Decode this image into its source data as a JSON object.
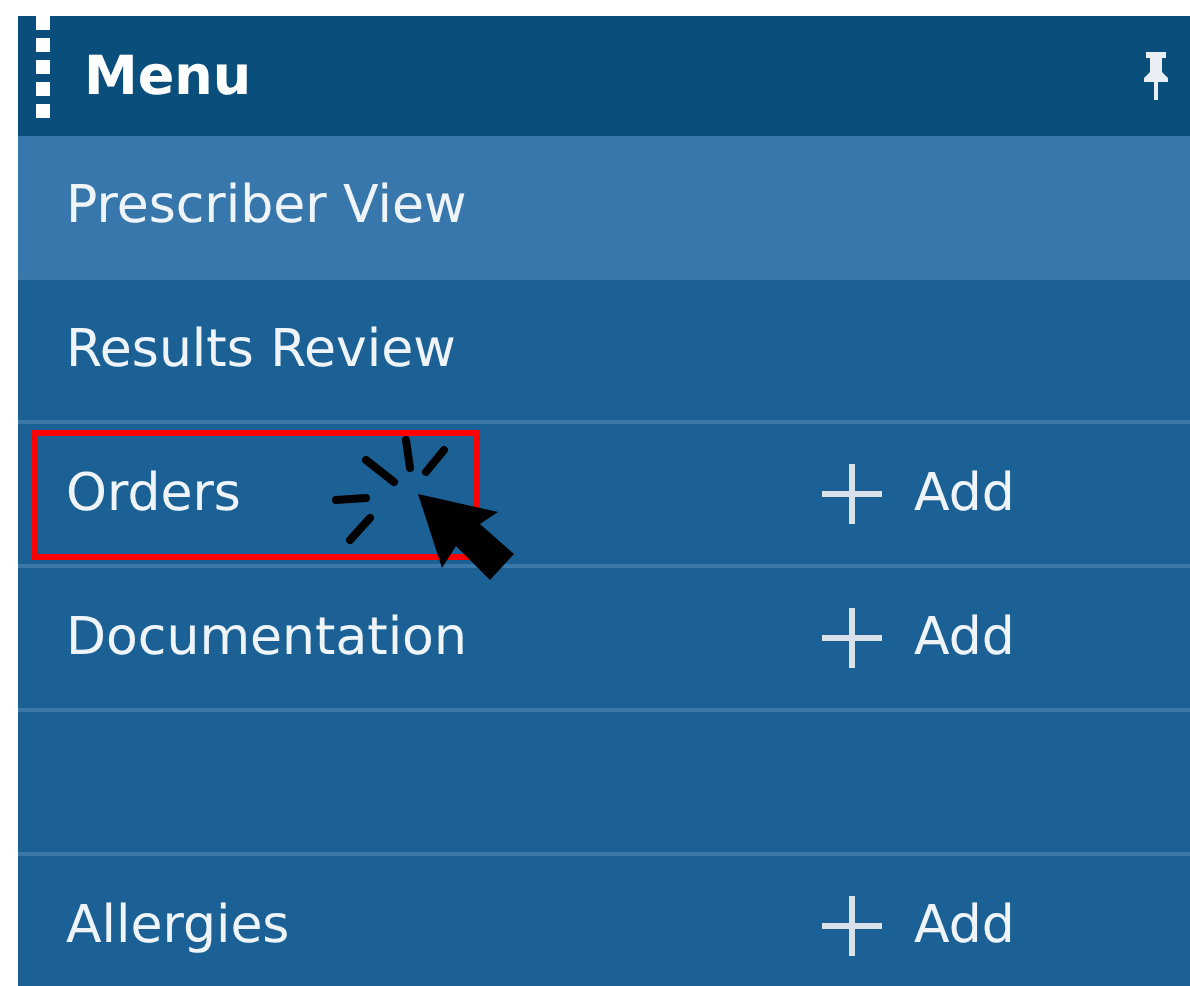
{
  "menu": {
    "title": "Menu",
    "items": [
      {
        "kind": "item",
        "label": "Prescriber View",
        "selected": true,
        "highlighted": false
      },
      {
        "kind": "item",
        "label": "Results Review",
        "selected": false,
        "highlighted": false
      },
      {
        "kind": "item",
        "label": "Orders",
        "selected": false,
        "highlighted": true,
        "action": "Add"
      },
      {
        "kind": "item",
        "label": "Documentation",
        "selected": false,
        "highlighted": false,
        "action": "Add"
      },
      {
        "kind": "spacer"
      },
      {
        "kind": "item",
        "label": "Allergies",
        "selected": false,
        "highlighted": false,
        "action": "Add"
      }
    ]
  }
}
